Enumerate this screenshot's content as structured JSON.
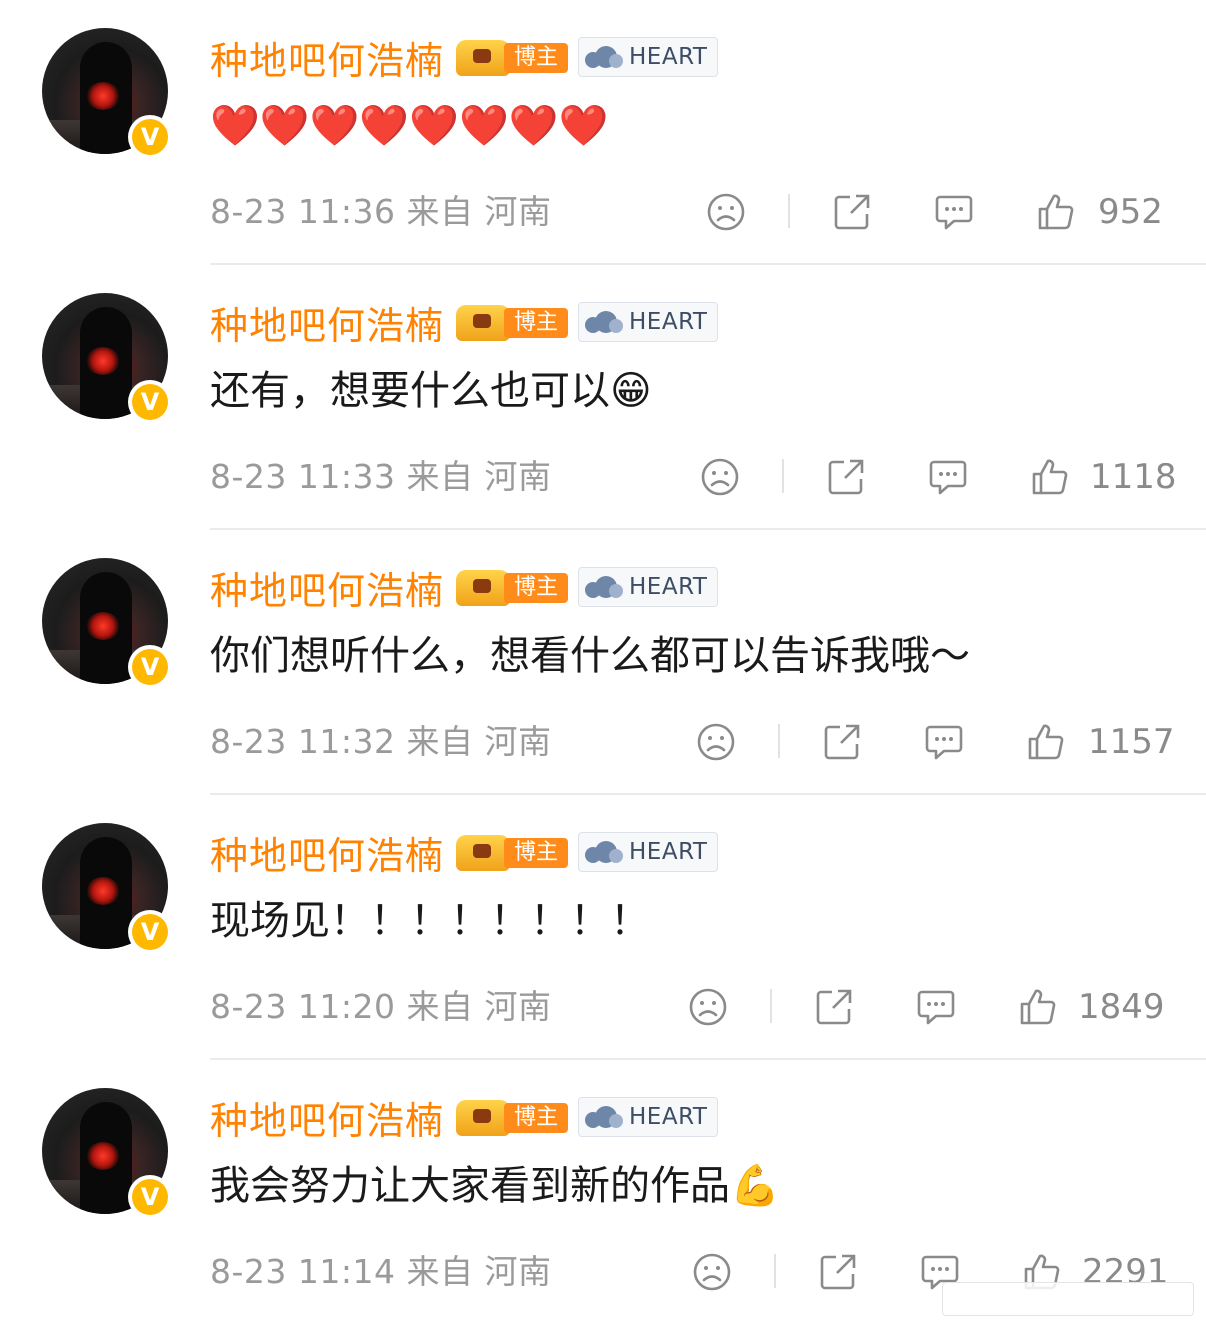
{
  "comments": [
    {
      "username": "种地吧何浩楠",
      "badge_blogger": "博主",
      "badge_fan": "HEART",
      "text": "❤️❤️❤️❤️❤️❤️❤️❤️",
      "time": "8-23 11:36",
      "source": "来自 河南",
      "likes": "952"
    },
    {
      "username": "种地吧何浩楠",
      "badge_blogger": "博主",
      "badge_fan": "HEART",
      "text": "还有，想要什么也可以😁",
      "time": "8-23 11:33",
      "source": "来自 河南",
      "likes": "1118"
    },
    {
      "username": "种地吧何浩楠",
      "badge_blogger": "博主",
      "badge_fan": "HEART",
      "text": "你们想听什么，想看什么都可以告诉我哦～",
      "time": "8-23 11:32",
      "source": "来自 河南",
      "likes": "1157"
    },
    {
      "username": "种地吧何浩楠",
      "badge_blogger": "博主",
      "badge_fan": "HEART",
      "text": "现场见！！！！！！！！",
      "time": "8-23 11:20",
      "source": "来自 河南",
      "likes": "1849"
    },
    {
      "username": "种地吧何浩楠",
      "badge_blogger": "博主",
      "badge_fan": "HEART",
      "text": "我会努力让大家看到新的作品💪",
      "time": "8-23 11:14",
      "source": "来自 河南",
      "likes": "2291"
    }
  ],
  "colors": {
    "username": "#ff8200",
    "meta": "#9a9a9a",
    "verified": "#ffb800"
  },
  "icons": [
    "sad-face-icon",
    "share-icon",
    "comment-icon",
    "thumbs-up-icon",
    "verified-v-icon",
    "crown-icon",
    "cloud-icon"
  ]
}
